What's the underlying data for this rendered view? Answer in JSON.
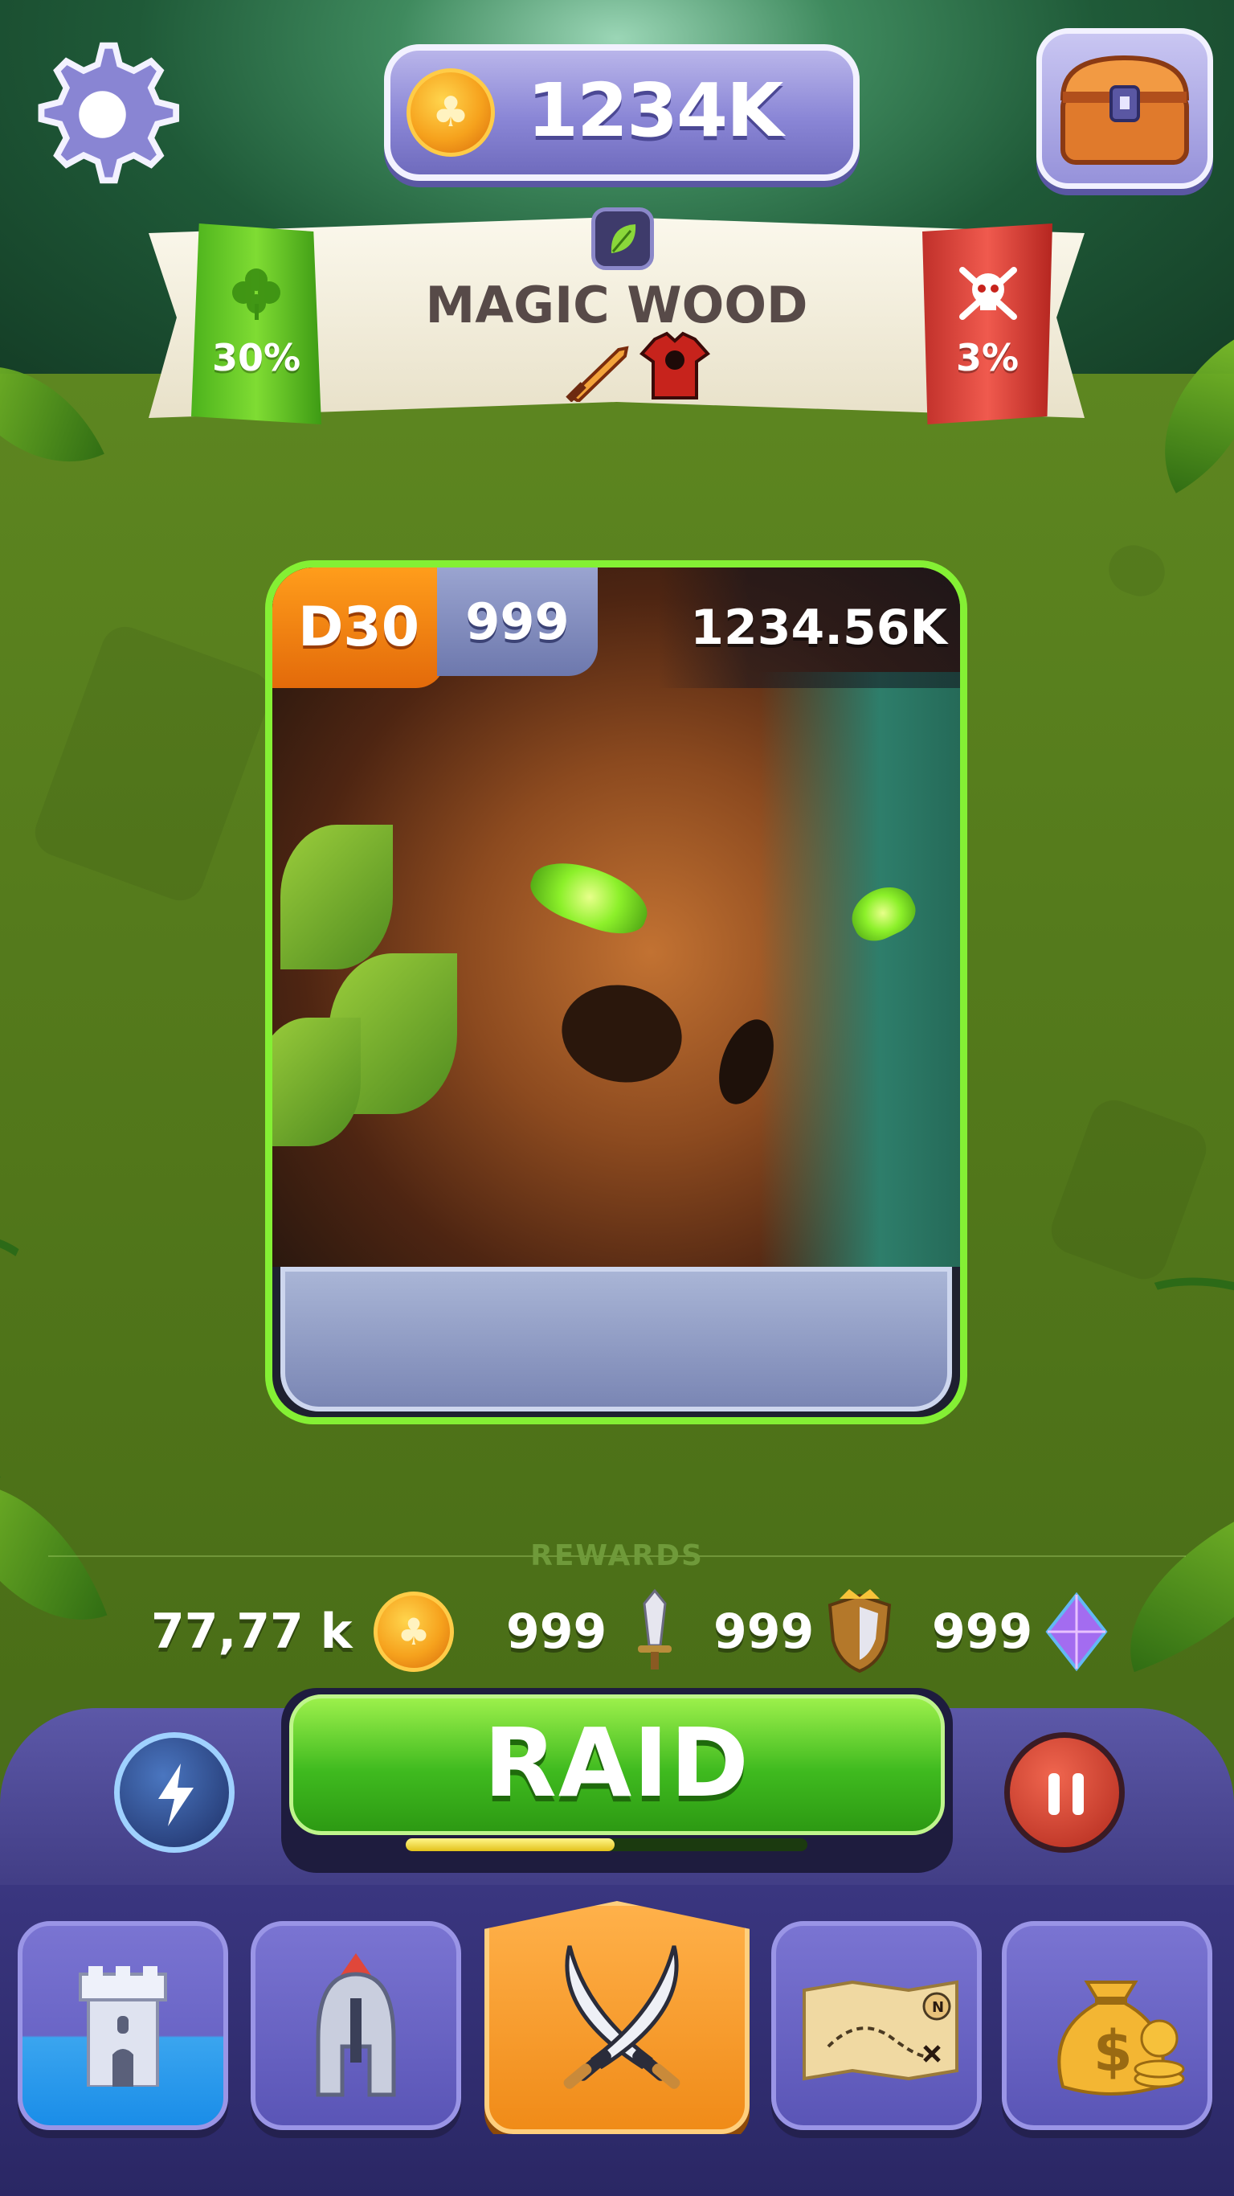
{
  "header": {
    "coin_amount": "1234K",
    "settings_icon": "gear-icon",
    "chest_icon": "treasure-chest-icon"
  },
  "location": {
    "name": "MAGIC WOOD",
    "biome_icon": "leaf-icon",
    "luck_percent": "30%",
    "luck_icon": "clover-icon",
    "danger_percent": "3%",
    "danger_icon": "skull-crossbones-icon",
    "drop_icons": [
      "fire-sword-icon",
      "red-armor-icon"
    ]
  },
  "enemy_card": {
    "level": "D30",
    "count": "999",
    "health": "1234.56K",
    "portrait": "tree-monster-portrait"
  },
  "rewards": {
    "label": "REWARDS",
    "items": [
      {
        "value": "77,77 k",
        "icon": "coin-icon"
      },
      {
        "value": "999",
        "icon": "sword-icon"
      },
      {
        "value": "999",
        "icon": "shield-icon"
      },
      {
        "value": "999",
        "icon": "gem-icon"
      }
    ]
  },
  "actions": {
    "raid_label": "RAID",
    "raid_progress": 0.52,
    "boost_icon": "lightning-potion-icon",
    "pause_icon": "pause-icon"
  },
  "nav": {
    "items": [
      {
        "icon": "castle-tower-icon",
        "active": false
      },
      {
        "icon": "spartan-helmet-icon",
        "active": false
      },
      {
        "icon": "crossed-swords-icon",
        "active": true
      },
      {
        "icon": "treasure-map-icon",
        "active": false
      },
      {
        "icon": "money-bag-icon",
        "active": false
      }
    ]
  },
  "colors": {
    "accent_green": "#84f034",
    "nav_purple": "#5a55b6",
    "active_orange": "#f08b18",
    "danger_red": "#e0423a"
  }
}
